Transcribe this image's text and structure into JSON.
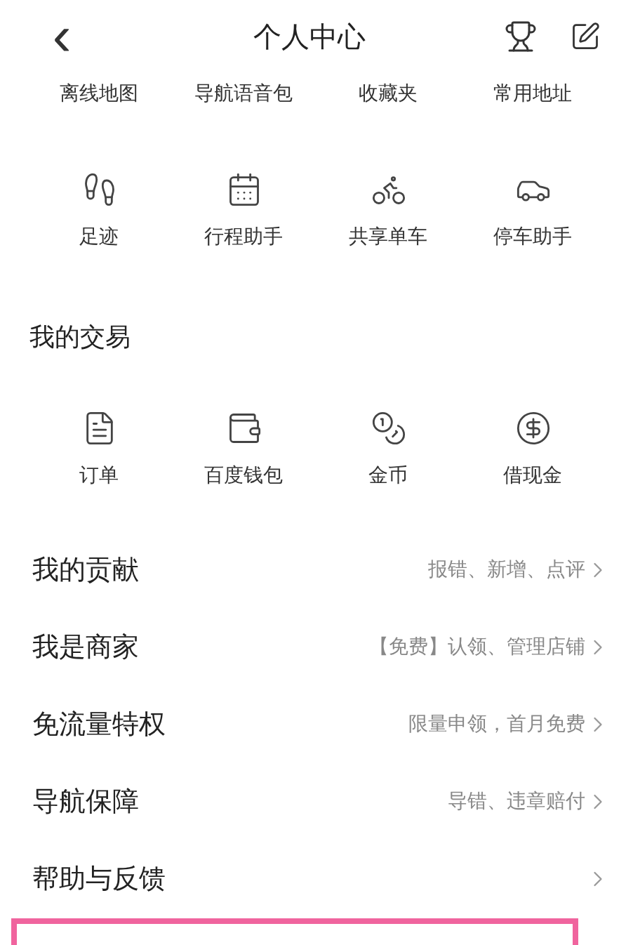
{
  "header": {
    "back": "‹",
    "title": "个人中心"
  },
  "tools_partial": [
    "离线地图",
    "导航语音包",
    "收藏夹",
    "常用地址"
  ],
  "tools": [
    "足迹",
    "行程助手",
    "共享单车",
    "停车助手"
  ],
  "trade": {
    "title": "我的交易",
    "items": [
      "订单",
      "百度钱包",
      "金币",
      "借现金"
    ]
  },
  "menu": [
    {
      "label": "我的贡献",
      "hint": "报错、新增、点评"
    },
    {
      "label": "我是商家",
      "hint": "【免费】认领、管理店铺"
    },
    {
      "label": "免流量特权",
      "hint": "限量申领，首月免费"
    },
    {
      "label": "导航保障",
      "hint": "导错、违章赔付"
    },
    {
      "label": "帮助与反馈"
    }
  ],
  "highlight": {
    "kind": "frame"
  }
}
